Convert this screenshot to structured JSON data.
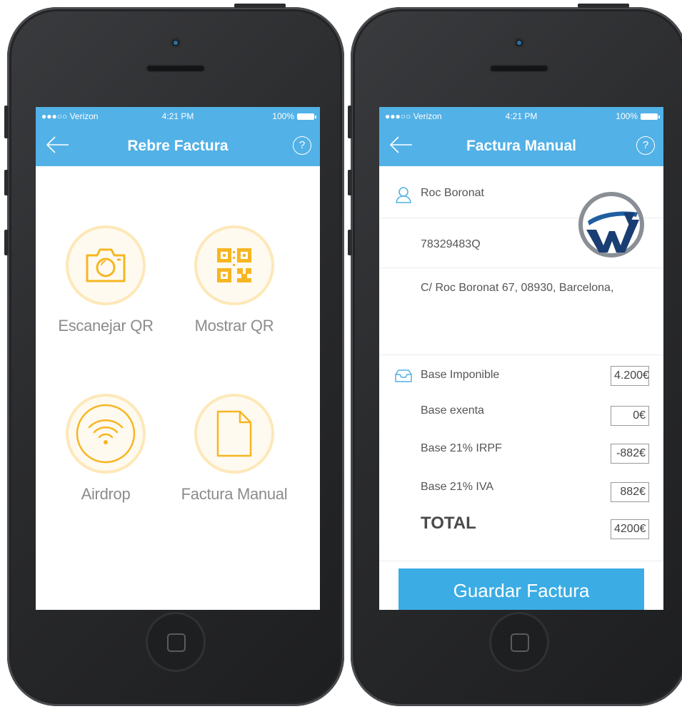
{
  "left_screen": {
    "status": {
      "carrier": "●●●○○ Verizon",
      "time": "4:21 PM",
      "battery": "100%"
    },
    "title": "Rebre Factura",
    "help_glyph": "?",
    "options": [
      {
        "label": "Escanejar QR",
        "icon": "camera-icon"
      },
      {
        "label": "Mostrar QR",
        "icon": "qr-code-icon"
      },
      {
        "label": "Airdrop",
        "icon": "wifi-icon"
      },
      {
        "label": "Factura Manual",
        "icon": "document-icon"
      }
    ]
  },
  "right_screen": {
    "status": {
      "carrier": "●●●○○ Verizon",
      "time": "4:21 PM",
      "battery": "100%"
    },
    "title": "Factura Manual",
    "help_glyph": "?",
    "client": {
      "name": "Roc Boronat",
      "nif": "78329483Q",
      "address": "C/ Roc Boronat 67, 08930, Barcelona,"
    },
    "amounts": [
      {
        "label": "Base Imponible",
        "value": "4.200€"
      },
      {
        "label": "Base exenta",
        "value": "0€"
      },
      {
        "label": "Base 21% IRPF",
        "value": "-882€"
      },
      {
        "label": "Base 21% IVA",
        "value": "882€"
      }
    ],
    "total": {
      "label": "TOTAL",
      "value": "4200€"
    },
    "save_label": "Guardar Factura",
    "accent": "#52b1e6",
    "icon_color": "#f6b622"
  }
}
